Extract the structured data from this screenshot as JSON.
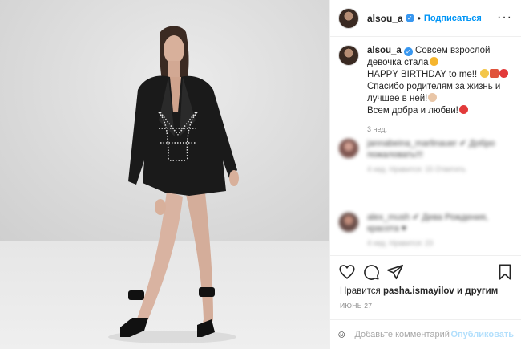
{
  "post": {
    "username": "alsou_a",
    "follow_label": "Подписаться",
    "separator": "•",
    "more_label": "···"
  },
  "caption": {
    "username": "alsou_a",
    "line1": "Совсем взрослой девочка стала",
    "line2": "HAPPY BIRTHDAY to me!!",
    "line3": "Спасибо родителям за жизнь и лучшее в ней!",
    "line4": "Всем добра и любви!",
    "time": "3 нед."
  },
  "comments_blurred": [
    {
      "line1": "jannabeina_marlinauer ✔ Добро",
      "line2": "пожаловать!!!",
      "meta": "4 нед.   Нравится: 15   Ответить"
    },
    {
      "line1": "alex_mush ✔ Дева Рождения,",
      "line2": "красота ♥",
      "meta": "4 нед.   Нравится: 23"
    }
  ],
  "likes": {
    "prefix": "Нравится",
    "user": "pasha.ismayilov",
    "suffix": "и другим"
  },
  "date": "июнь 27",
  "add_comment": {
    "placeholder": "Добавьте комментарий...",
    "post_label": "Опубликовать"
  },
  "colors": {
    "accent": "#0095f6",
    "verified": "#3897f0",
    "muted": "#8e8e8e",
    "post_disabled": "#b2dffc"
  },
  "icons": [
    "heart-icon",
    "comment-icon",
    "share-icon",
    "bookmark-icon",
    "emoji-icon",
    "verified-icon"
  ]
}
